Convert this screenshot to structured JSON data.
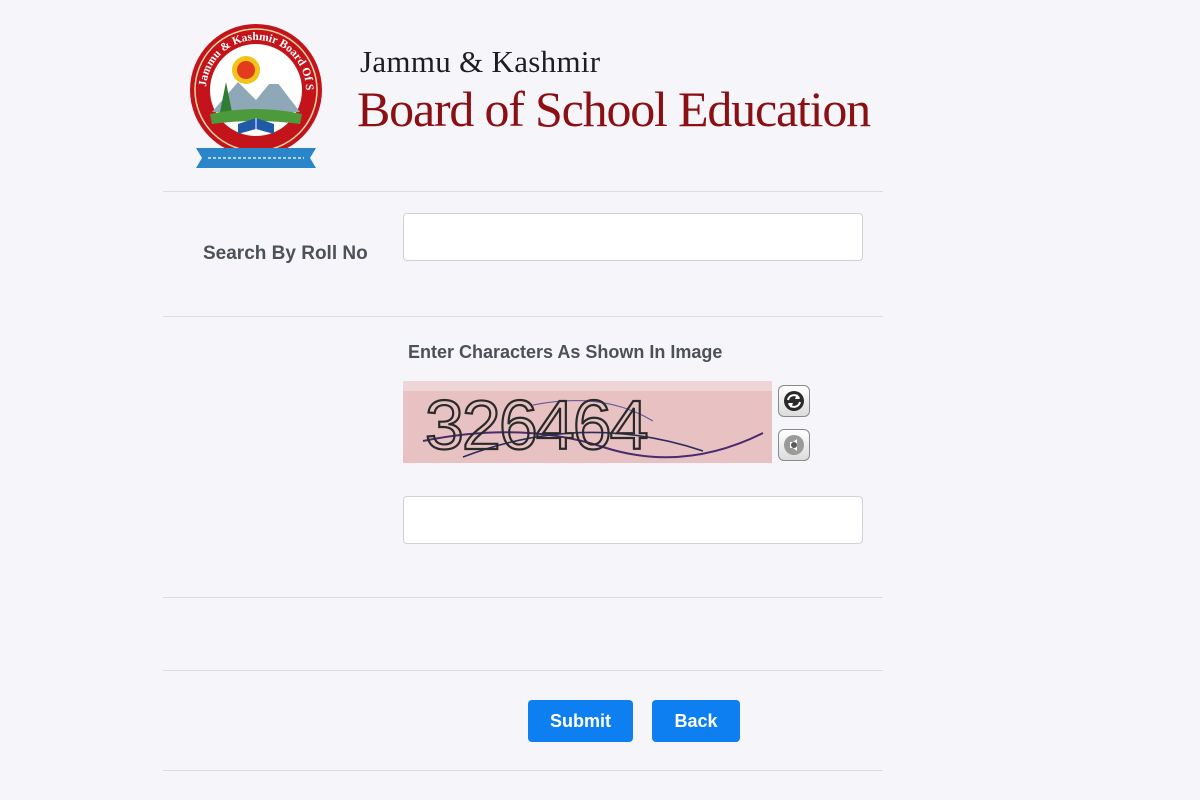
{
  "header": {
    "org_line1": "Jammu & Kashmir",
    "org_line2": "Board of School Education",
    "logo_ring_text": "Jammu & Kashmir Board Of School Education",
    "logo_icon": "jkbose-emblem-icon"
  },
  "form": {
    "roll_label": "Search By Roll No",
    "roll_value": "",
    "captcha_label": "Enter Characters As Shown In Image",
    "captcha_code": "326464",
    "captcha_value": "",
    "refresh_icon": "refresh-icon",
    "audio_icon": "audio-icon"
  },
  "buttons": {
    "submit": "Submit",
    "back": "Back"
  },
  "colors": {
    "brand_red": "#8b1014",
    "button_blue": "#0d7ff0",
    "captcha_bg": "#e8c2c2"
  }
}
